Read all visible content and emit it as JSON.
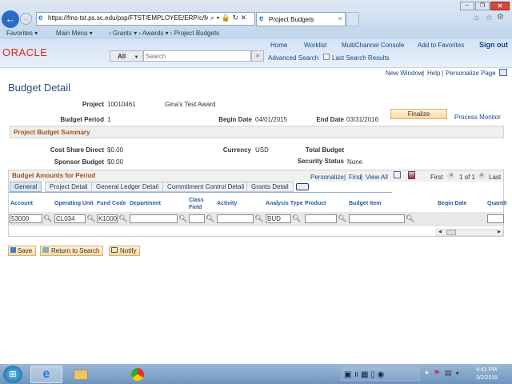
{
  "browser": {
    "url": "https://fms-tst.ps.sc.edu/psp/FTST/EMPLOYEE/ERP/c/MANA",
    "tab_title": "Project Budgets"
  },
  "favbar": {
    "favorites": "Favorites",
    "main_menu": "Main Menu",
    "crumbs": [
      "Grants",
      "Awards",
      "Project Budgets"
    ]
  },
  "header": {
    "logo": "ORACLE",
    "links": [
      "Home",
      "Worklist",
      "MultiChannel Console",
      "Add to Favorites",
      "Sign out"
    ],
    "search_scope": "All",
    "search_placeholder": "Search",
    "advanced_search": "Advanced Search",
    "last_search": "Last Search Results"
  },
  "pagebar": {
    "new_window": "New Window",
    "help": "Help",
    "personalize": "Personalize Page"
  },
  "page": {
    "title": "Budget Detail",
    "project_label": "Project",
    "project": "10010461",
    "project_desc": "Gina's Test Award",
    "period_label": "Budget Period",
    "period": "1",
    "begin_label": "Begin Date",
    "begin": "04/01/2015",
    "end_label": "End Date",
    "end": "03/31/2016",
    "finalize": "Finalize",
    "process_monitor": "Process Monitor"
  },
  "summary": {
    "title": "Project Budget Summary",
    "cost_share_label": "Cost Share Direct",
    "cost_share": "$0.00",
    "sponsor_label": "Sponsor Budget",
    "sponsor": "$0.00",
    "currency_label": "Currency",
    "currency": "USD",
    "total_label": "Total Budget",
    "security_label": "Security Status",
    "security": "None"
  },
  "grid": {
    "title": "Budget Amounts for Period",
    "personalize": "Personalize",
    "find": "Find",
    "view_all": "View All",
    "first": "First",
    "count": "1 of 1",
    "last": "Last",
    "tabs": [
      "General",
      "Project Detail",
      "General Ledger Detail",
      "Commitment Control Detail",
      "Grants Detail"
    ],
    "columns": [
      "Account",
      "Operating Unit",
      "Fund Code",
      "Department",
      "Class Field",
      "Activity",
      "Analysis Type",
      "Product",
      "Budget Item",
      "Begin Date",
      "Quantit"
    ],
    "row": {
      "account": "53000",
      "operating_unit": "CL034",
      "fund_code": "K1000",
      "department": "",
      "class_field": "",
      "activity": "",
      "analysis_type": "BUD",
      "product": "",
      "budget_item": "",
      "quantity": ""
    }
  },
  "buttons": {
    "save": "Save",
    "return": "Return to Search",
    "notify": "Notify"
  },
  "taskbar": {
    "time": "4:41 PM",
    "date": "3/2/2015"
  }
}
